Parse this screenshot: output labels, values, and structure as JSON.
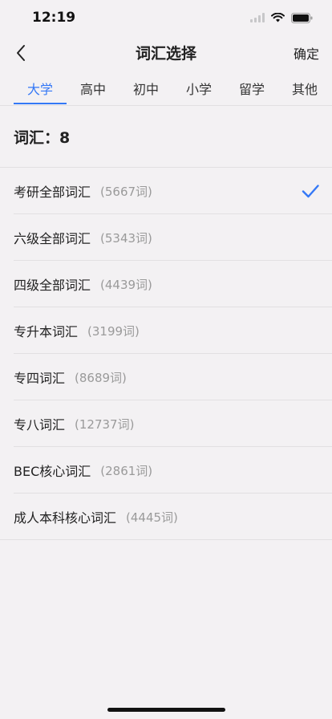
{
  "status_bar": {
    "time": "12:19",
    "icons": [
      "cellular-icon",
      "wifi-icon",
      "battery-icon"
    ]
  },
  "nav": {
    "title": "词汇选择",
    "back_icon": "chevron-left-icon",
    "confirm_label": "确定"
  },
  "tabs": [
    {
      "label": "大学",
      "active": true
    },
    {
      "label": "高中",
      "active": false
    },
    {
      "label": "初中",
      "active": false
    },
    {
      "label": "小学",
      "active": false
    },
    {
      "label": "留学",
      "active": false
    },
    {
      "label": "其他",
      "active": false
    }
  ],
  "vocab_count": {
    "text": "词汇：8"
  },
  "vocab_list": [
    {
      "name": "考研全部词汇",
      "count": "(5667词)",
      "selected": true
    },
    {
      "name": "六级全部词汇",
      "count": "(5343词)",
      "selected": false
    },
    {
      "name": "四级全部词汇",
      "count": "(4439词)",
      "selected": false
    },
    {
      "name": "专升本词汇",
      "count": "(3199词)",
      "selected": false
    },
    {
      "name": "专四词汇",
      "count": "(8689词)",
      "selected": false
    },
    {
      "name": "专八词汇",
      "count": "(12737词)",
      "selected": false
    },
    {
      "name": "BEC核心词汇",
      "count": "(2861词)",
      "selected": false
    },
    {
      "name": "成人本科核心词汇",
      "count": "(4445词)",
      "selected": false
    }
  ],
  "colors": {
    "accent": "#3478f6",
    "background": "#f3f1f3",
    "secondary_text": "#9a9a9a",
    "divider": "#e2e0e2"
  }
}
